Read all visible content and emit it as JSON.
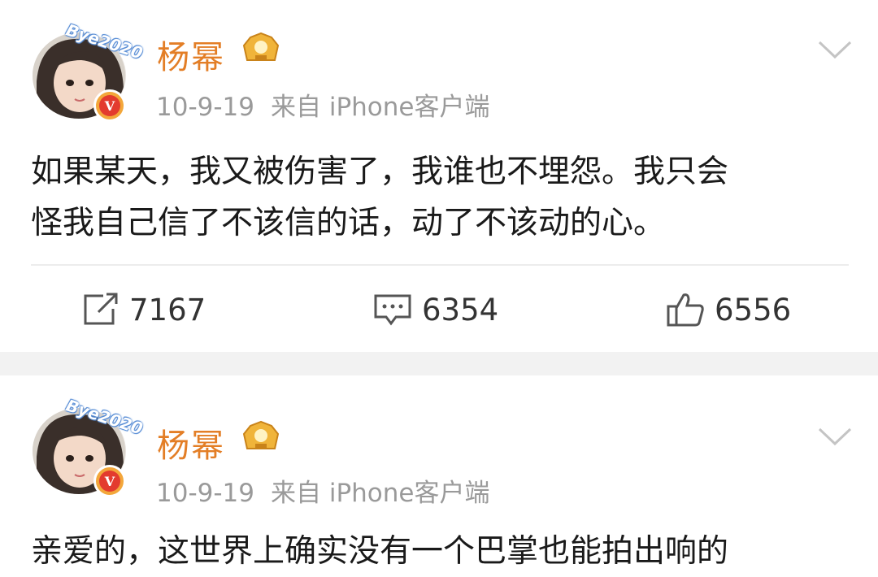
{
  "posts": [
    {
      "author": "杨幂",
      "avatar_banner": "Bye2020",
      "verified_mark": "V",
      "date": "10-9-19",
      "source": "来自 iPhone客户端",
      "text_lines": [
        "如果某天，我又被伤害了，我谁也不埋怨。我只会",
        "怪我自己信了不该信的话，动了不该动的心。"
      ],
      "actions": {
        "repost_count": "7167",
        "comment_count": "6354",
        "like_count": "6556"
      },
      "icons": [
        "avatar",
        "verified-icon",
        "vip-crown-icon",
        "chevron-down-icon",
        "repost-icon",
        "comment-icon",
        "like-icon"
      ]
    },
    {
      "author": "杨幂",
      "avatar_banner": "Bye2020",
      "verified_mark": "V",
      "date": "10-9-19",
      "source": "来自 iPhone客户端",
      "text_lines": [
        "亲爱的，这世界上确实没有一个巴掌也能拍出响的"
      ]
    }
  ],
  "colors": {
    "username": "#e37e26",
    "meta": "#9a9a9a",
    "divider_band": "#f2f2f2",
    "verified_badge": "#f3a73b"
  }
}
